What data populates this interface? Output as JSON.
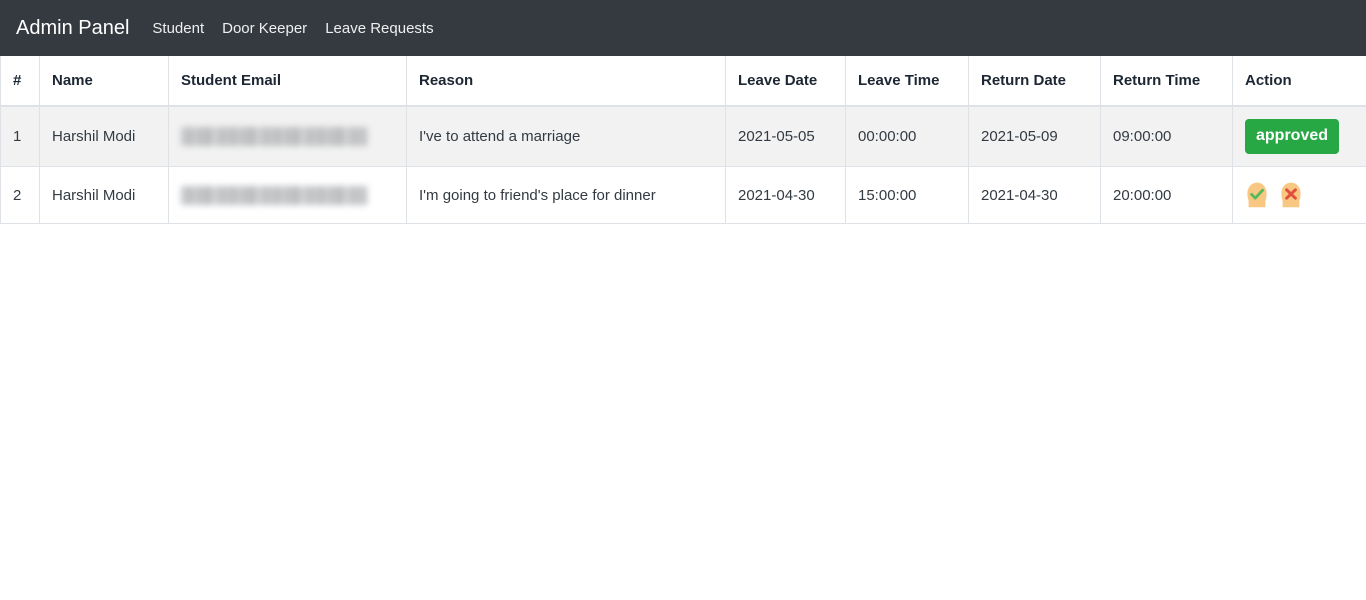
{
  "navbar": {
    "brand": "Admin Panel",
    "links": [
      {
        "label": "Student"
      },
      {
        "label": "Door Keeper"
      },
      {
        "label": "Leave Requests"
      }
    ],
    "background_color": "#343a40"
  },
  "table": {
    "headers": {
      "num": "#",
      "name": "Name",
      "email": "Student Email",
      "reason": "Reason",
      "leave_date": "Leave Date",
      "leave_time": "Leave Time",
      "return_date": "Return Date",
      "return_time": "Return Time",
      "action": "Action"
    },
    "rows": [
      {
        "num": "1",
        "name": "Harshil Modi",
        "email": "",
        "email_redacted": true,
        "reason": "I've to attend a marriage",
        "leave_date": "2021-05-05",
        "leave_time": "00:00:00",
        "return_date": "2021-05-09",
        "return_time": "09:00:00",
        "action_type": "badge",
        "action_label": "approved"
      },
      {
        "num": "2",
        "name": "Harshil Modi",
        "email": "",
        "email_redacted": true,
        "reason": "I'm going to friend's place for dinner",
        "leave_date": "2021-04-30",
        "leave_time": "15:00:00",
        "return_date": "2021-04-30",
        "return_time": "20:00:00",
        "action_type": "icons",
        "action_icons": [
          {
            "name": "approve-check-icon",
            "glyph": "check",
            "circle_color": "#f8c882",
            "mark_color": "#5ab85c"
          },
          {
            "name": "reject-cross-icon",
            "glyph": "cross",
            "circle_color": "#f8c882",
            "mark_color": "#e24d3d"
          }
        ]
      }
    ]
  },
  "colors": {
    "navbar_bg": "#343a40",
    "badge_green": "#28a745",
    "row_stripe": "#f2f2f2",
    "border": "#dee2e6",
    "text": "#333a42"
  }
}
